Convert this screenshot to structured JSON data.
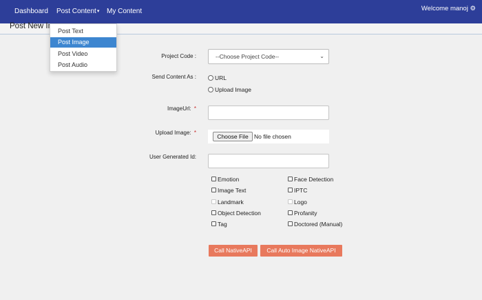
{
  "navbar": {
    "items": [
      "Dashboard",
      "Post Content",
      "My Content"
    ],
    "welcome": "Welcome manoj",
    "welcome_icon": "gear-icon",
    "caret_icon": "caret-down-icon",
    "background": "#2d3e99"
  },
  "page": {
    "title": "Post New Image"
  },
  "dropdown": {
    "items": [
      "Post Text",
      "Post Image",
      "Post Video",
      "Post Audio"
    ],
    "active": "Post Image",
    "active_color": "#3d86d0"
  },
  "form": {
    "project_code": {
      "label": "Project Code :",
      "value": "--Choose Project Code--"
    },
    "send_content": {
      "label": "Send Content As :",
      "options": [
        "URL",
        "Upload Image"
      ]
    },
    "image_url": {
      "label": "ImageUrl: ",
      "required": "*",
      "value": ""
    },
    "upload_image": {
      "label": "Upload Image: ",
      "required": "*",
      "button": "Choose File",
      "status": "No file chosen"
    },
    "user_id": {
      "label": "User Generated Id:",
      "value": ""
    },
    "features_left": [
      "Emotion",
      "Image Text",
      "Landmark",
      "Object Detection",
      "Tag"
    ],
    "features_right": [
      "Face Detection",
      "IPTC",
      "Logo",
      "Profanity",
      "Doctored (Manual)"
    ],
    "disabled_features": [
      "Landmark",
      "Logo"
    ],
    "buttons": [
      "Call NativeAPI",
      "Call Auto Image NativeAPI"
    ],
    "button_color": "#e8795d"
  }
}
